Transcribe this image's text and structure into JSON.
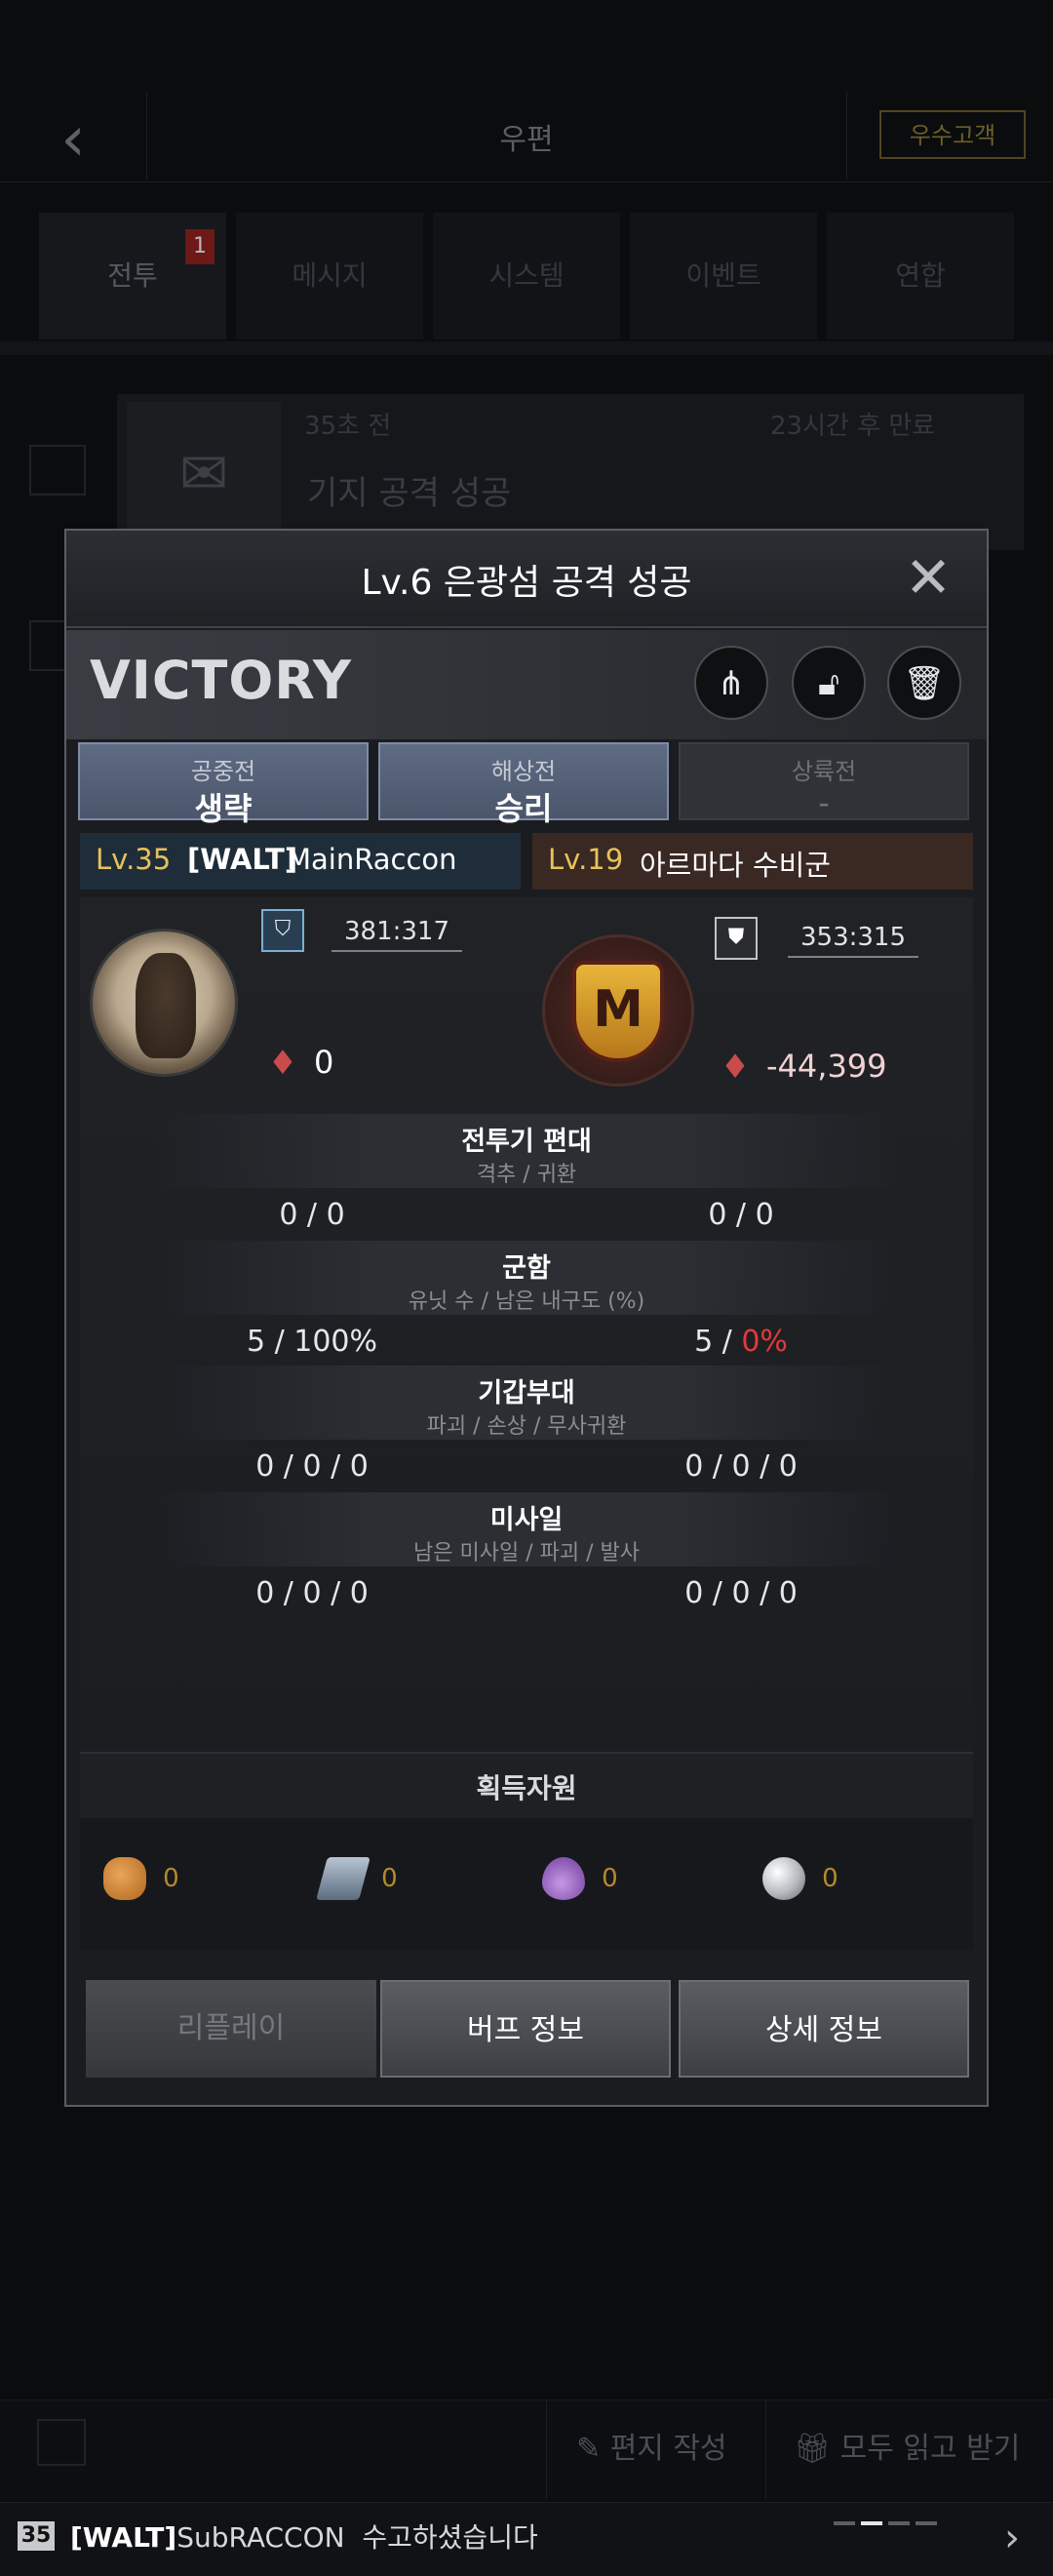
{
  "header": {
    "title": "우편",
    "vip_label": "우수고객"
  },
  "tabs": [
    {
      "label": "전투",
      "badge": "1"
    },
    {
      "label": "메시지"
    },
    {
      "label": "시스템"
    },
    {
      "label": "이벤트"
    },
    {
      "label": "연합"
    }
  ],
  "mail_preview": {
    "age": "35초 전",
    "expires": "23시간 후 만료",
    "title": "기지 공격 성공"
  },
  "modal": {
    "title": "Lv.6 은광섬 공격 성공",
    "result": "VICTORY",
    "phases": [
      {
        "label": "공중전",
        "value": "생략"
      },
      {
        "label": "해상전",
        "value": "승리"
      },
      {
        "label": "상륙전",
        "value": "-"
      }
    ],
    "attacker": {
      "level": "Lv.35",
      "tag": "[WALT]",
      "name": "MainRaccon",
      "ratio": "381:317",
      "power": "0"
    },
    "defender": {
      "level": "Lv.19",
      "name": "아르마다 수비군",
      "ratio": "353:315",
      "power": "-44,399"
    },
    "sections": [
      {
        "title": "전투기 편대",
        "sub": "격추 / 귀환",
        "left": "0 / 0",
        "right": "0 / 0"
      },
      {
        "title": "군함",
        "sub": "유닛 수 / 남은 내구도 (%)",
        "left": "5 / 100%",
        "right_a": "5 / ",
        "right_b": "0%"
      },
      {
        "title": "기갑부대",
        "sub": "파괴 / 손상 / 무사귀환",
        "left": "0 / 0 / 0",
        "right": "0 / 0 / 0"
      },
      {
        "title": "미사일",
        "sub": "남은 미사일 / 파괴 / 발사",
        "left": "0 / 0 / 0",
        "right": "0 / 0 / 0"
      }
    ],
    "resources_title": "획득자원",
    "resources": [
      {
        "icon": "bread-icon",
        "value": "0"
      },
      {
        "icon": "steel-icon",
        "value": "0"
      },
      {
        "icon": "oil-drop-icon",
        "value": "0"
      },
      {
        "icon": "silver-orb-icon",
        "value": "0"
      }
    ],
    "buttons": {
      "replay": "리플레이",
      "buff": "버프 정보",
      "detail": "상세 정보"
    }
  },
  "bottom": {
    "write": "편지 작성",
    "read_all": "모두 읽고 받기"
  },
  "chat": {
    "level": "35",
    "tag": "[WALT]",
    "name": "SubRACCON",
    "message": "수고하셨습니다"
  }
}
